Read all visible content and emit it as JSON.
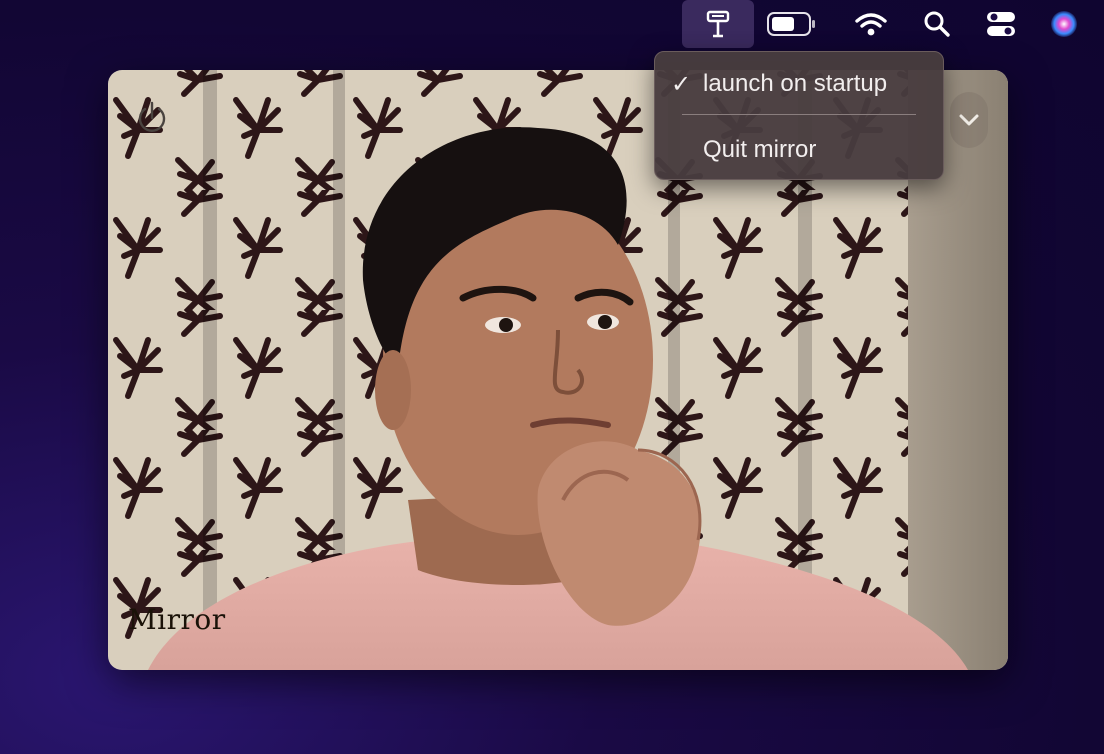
{
  "menubar": {
    "items": [
      {
        "name": "mirror-app-icon",
        "active": true
      },
      {
        "name": "battery-icon"
      },
      {
        "name": "wifi-icon"
      },
      {
        "name": "search-icon"
      },
      {
        "name": "control-center-icon"
      },
      {
        "name": "siri-icon"
      }
    ]
  },
  "dropdown": {
    "items": [
      {
        "label": "launch on startup",
        "checked": true,
        "check_glyph": "✓"
      },
      {
        "label": "Quit mirror",
        "checked": false
      }
    ]
  },
  "mirror": {
    "label": "Mirror",
    "icons": {
      "power": "power-icon",
      "chevron": "chevron-down-icon"
    }
  },
  "colors": {
    "desktop_bg": "#14073a",
    "menu_bg": "#483c3e",
    "menu_text": "#f2eeee",
    "active_menubar_item": "#3a2a5e"
  }
}
